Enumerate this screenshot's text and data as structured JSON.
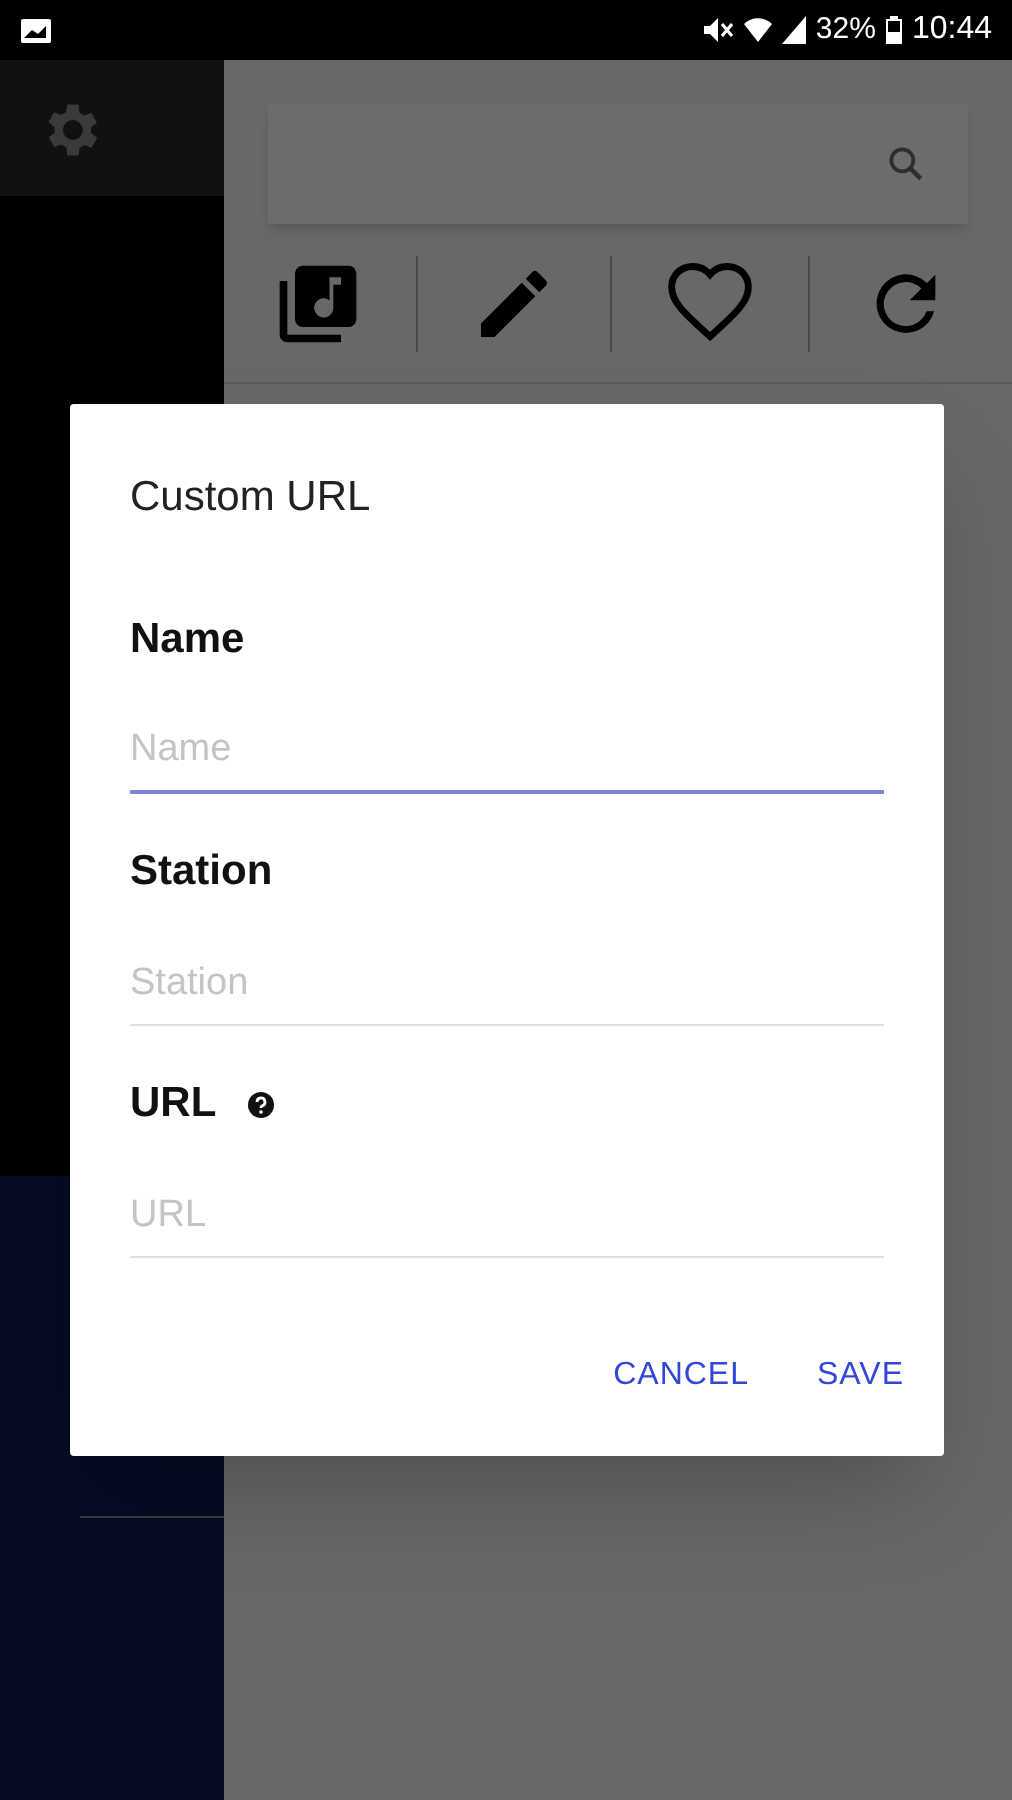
{
  "status_bar": {
    "battery": "32%",
    "time": "10:44"
  },
  "dialog": {
    "title": "Custom URL",
    "fields": [
      {
        "label": "Name",
        "placeholder": "Name",
        "focused": true,
        "help": false
      },
      {
        "label": "Station",
        "placeholder": "Station",
        "focused": false,
        "help": false
      },
      {
        "label": "URL",
        "placeholder": "URL",
        "focused": false,
        "help": true
      }
    ],
    "buttons": [
      "CANCEL",
      "SAVE"
    ]
  }
}
